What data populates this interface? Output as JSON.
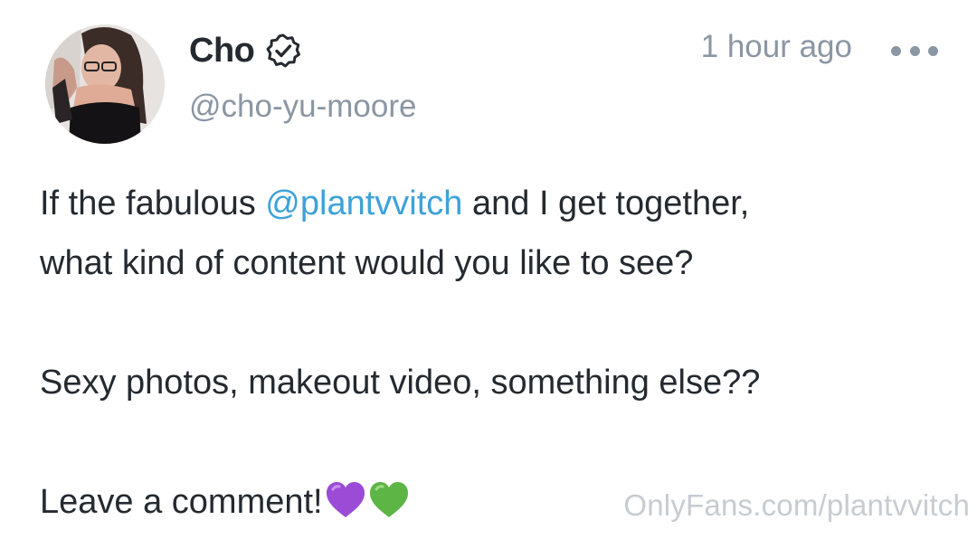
{
  "post": {
    "author": {
      "display_name": "Cho",
      "handle": "@cho-yu-moore",
      "verified_icon": "verified-badge-icon",
      "avatar": "profile-photo"
    },
    "timestamp": "1 hour ago",
    "more_icon": "more-horizontal-icon",
    "body": {
      "line1_before": "If the fabulous ",
      "mention": "@plantvvitch",
      "line1_after": " and I get together,",
      "line2": "what kind of content would you like to see?",
      "line3": "Sexy photos, makeout video, something else??",
      "line4": "Leave a comment!",
      "emojis": [
        "purple-heart-icon",
        "green-heart-icon"
      ]
    },
    "watermark": "OnlyFans.com/plantvvitch"
  },
  "colors": {
    "text": "#242a30",
    "muted": "#8a96a3",
    "link": "#3ea2d8",
    "watermark": "#c7ccd1",
    "purple_heart": "#9b4bd6",
    "green_heart": "#5cb545"
  }
}
